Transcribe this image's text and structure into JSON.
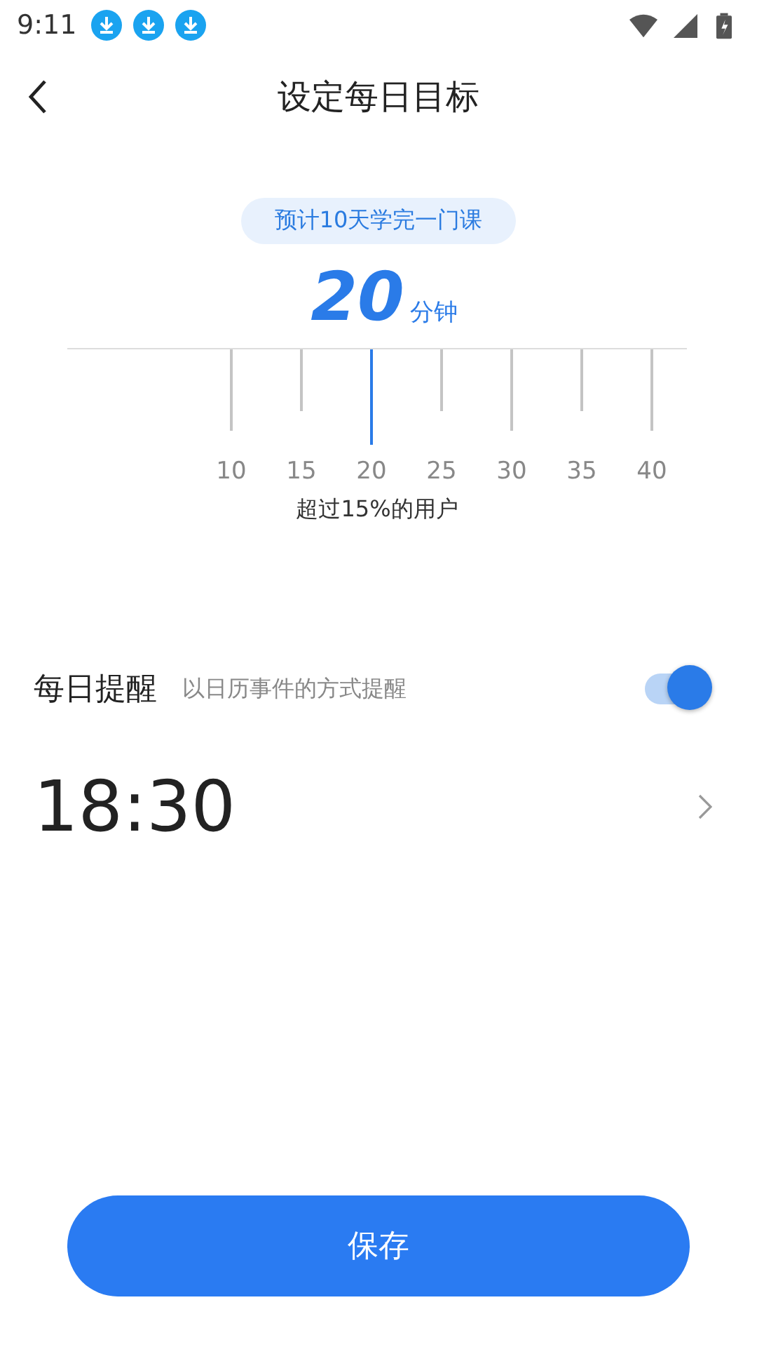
{
  "status_bar": {
    "time": "9:11"
  },
  "header": {
    "title": "设定每日目标"
  },
  "goal": {
    "estimate": "预计10天学完一门课",
    "value": "20",
    "unit": "分钟",
    "ticks": [
      {
        "label": "10",
        "selected": false
      },
      {
        "label": "15",
        "selected": false
      },
      {
        "label": "20",
        "selected": true
      },
      {
        "label": "25",
        "selected": false
      },
      {
        "label": "30",
        "selected": false
      },
      {
        "label": "35",
        "selected": false
      },
      {
        "label": "40",
        "selected": false
      }
    ],
    "caption": "超过15%的用户"
  },
  "reminder": {
    "label": "每日提醒",
    "description": "以日历事件的方式提醒",
    "on": true
  },
  "time": {
    "value": "18:30"
  },
  "save_button": {
    "label": "保存"
  }
}
